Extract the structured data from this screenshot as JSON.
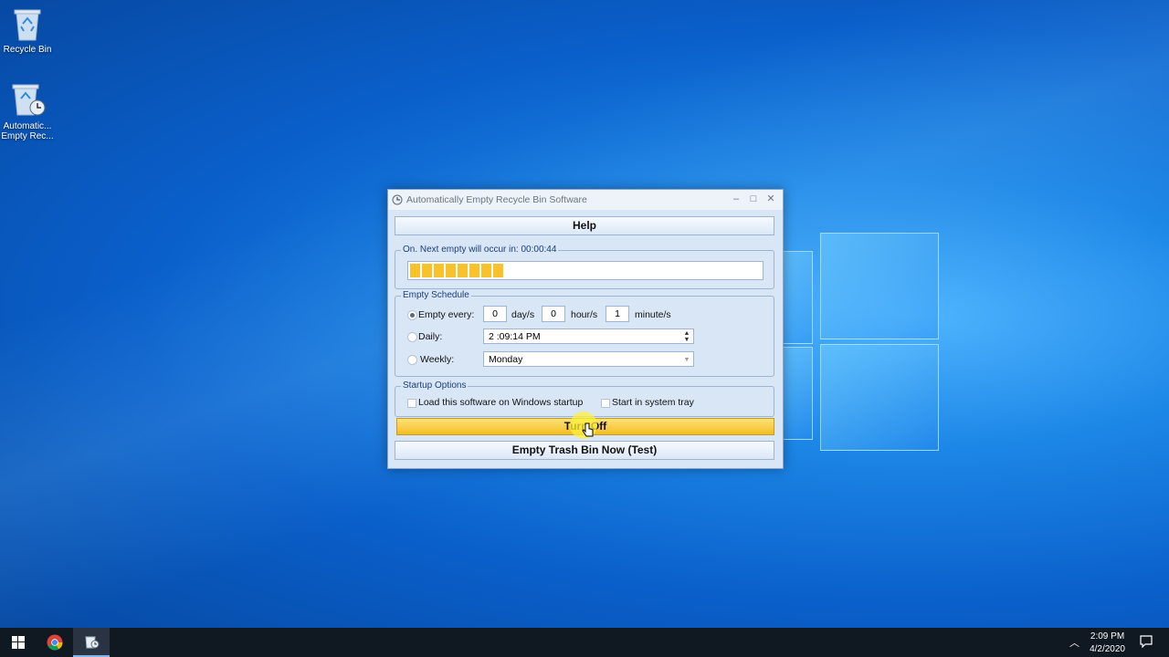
{
  "desktop": {
    "icons": [
      {
        "label": "Recycle Bin"
      },
      {
        "label": "Automatic... Empty Rec..."
      }
    ]
  },
  "window": {
    "title": "Automatically Empty Recycle Bin Software",
    "help_label": "Help",
    "status_group_label": "On. Next empty will occur in: 00:00:44",
    "progress_percent": 28,
    "schedule": {
      "group_label": "Empty Schedule",
      "empty_every_label": "Empty every:",
      "days_value": "0",
      "days_unit": "day/s",
      "hours_value": "0",
      "hours_unit": "hour/s",
      "minutes_value": "1",
      "minutes_unit": "minute/s",
      "daily_label": "Daily:",
      "daily_time": "2 :09:14 PM",
      "weekly_label": "Weekly:",
      "weekly_day": "Monday"
    },
    "startup": {
      "group_label": "Startup Options",
      "load_on_startup_label": "Load this software on Windows startup",
      "system_tray_label": "Start in system tray"
    },
    "turn_off_label": "Turn Off",
    "empty_now_label": "Empty Trash Bin Now (Test)"
  },
  "taskbar": {
    "time": "2:09 PM",
    "date": "4/2/2020"
  },
  "colors": {
    "progress_fill": "#f7c22a",
    "turn_off_bg": "#f2bd22"
  }
}
